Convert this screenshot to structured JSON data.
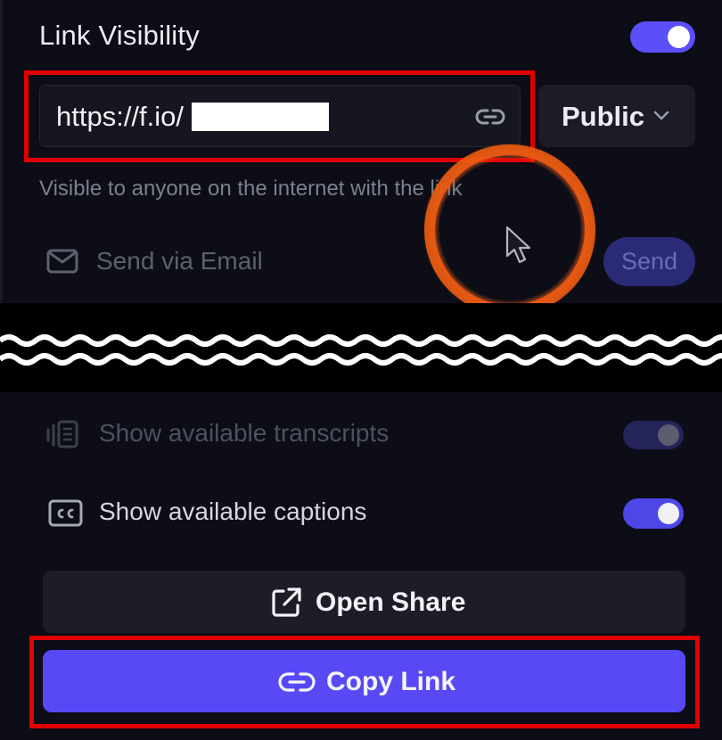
{
  "panel": {
    "title": "Link Visibility",
    "link_visibility_enabled": true
  },
  "url_field": {
    "value": "https://f.io/",
    "redacted": true
  },
  "visibility_select": {
    "selected": "Public"
  },
  "visibility_hint": "Visible to anyone on the internet with the link",
  "email": {
    "label": "Send via Email",
    "send_label": "Send"
  },
  "options": {
    "transcripts_label": "Show available transcripts",
    "transcripts_enabled": true,
    "captions_label": "Show available captions",
    "captions_enabled": true
  },
  "actions": {
    "open_share_label": "Open Share",
    "copy_link_label": "Copy Link"
  },
  "colors": {
    "background": "#0c0d16",
    "accent": "#5948f5",
    "highlight": "#e00000",
    "cursor_ring": "#e0561a"
  },
  "icons": {
    "url_field": "link-icon",
    "email": "mail-icon",
    "transcripts": "transcript-icon",
    "captions": "cc-icon",
    "open_share": "external-link-icon",
    "copy_link": "link-icon"
  }
}
